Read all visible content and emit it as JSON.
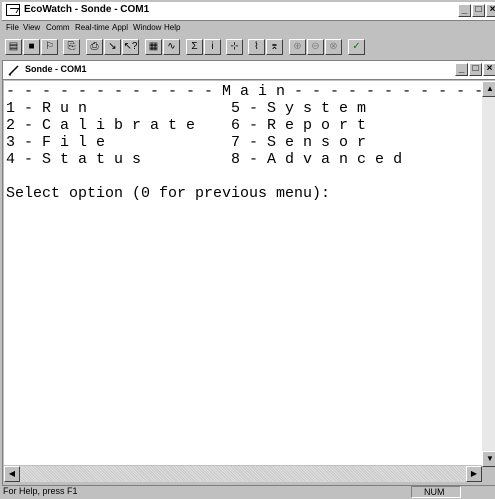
{
  "app": {
    "title": "EcoWatch - Sonde - COM1"
  },
  "menu": {
    "items": [
      "File",
      "View",
      "Comm",
      "Real-time",
      "Appl",
      "Window",
      "Help"
    ]
  },
  "toolbar": {
    "icons": [
      "open-icon",
      "save-icon",
      "properties-icon",
      "copy-icon",
      "print-icon",
      "probe-icon",
      "help-pointer-icon",
      "table-icon",
      "graph-icon",
      "statistics-icon",
      "info-icon",
      "plot-icon",
      "chart-icon",
      "chart2-icon",
      "zoom-in-icon",
      "zoom-out-icon",
      "zoom-reset-icon",
      "check-icon"
    ]
  },
  "child": {
    "title": "Sonde - COM1"
  },
  "terminal": {
    "lines": [
      "- - - - - - - - - - - - M a i n - - - - - - - - - - - - - -",
      "1 - R u n                5 - S y s t e m",
      "2 - C a l i b r a t e    6 - R e p o r t",
      "3 - F i l e              7 - S e n s o r",
      "4 - S t a t u s          8 - A d v a n c e d",
      "",
      "Select option (0 for previous menu):"
    ]
  },
  "status": {
    "help": "For Help, press F1",
    "num": "NUM"
  }
}
